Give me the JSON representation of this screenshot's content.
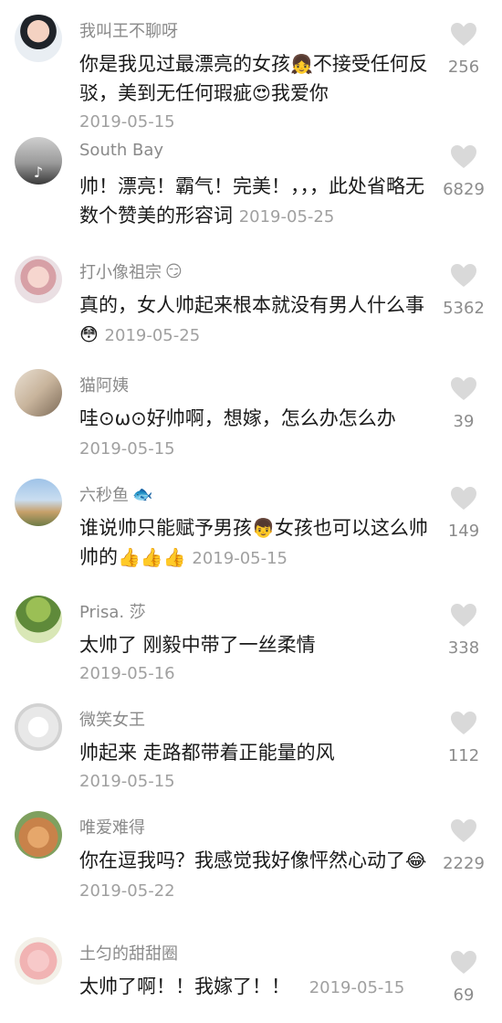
{
  "comments": [
    {
      "user": "我叫王不聊呀",
      "user_badge": "",
      "text": "你是我见过最漂亮的女孩👧不接受任何反驳，美到无任何瑕疵😍我爱你",
      "date": "2019-05-15",
      "likes": "256",
      "avatar_icon": "girl-portrait"
    },
    {
      "user": "South Bay",
      "user_badge": "",
      "text": "帅！漂亮！霸气！完美！，，，此处省略无数个赞美的形容词",
      "date": "2019-05-25",
      "likes": "6829",
      "avatar_icon": "tiktok-logo"
    },
    {
      "user": "打小像祖宗",
      "user_badge": "😏",
      "text": "真的，女人帅起来根本就没有男人什么事😳",
      "date": "2019-05-25",
      "likes": "5362",
      "avatar_icon": "girl-selfie"
    },
    {
      "user": "猫阿姨",
      "user_badge": "",
      "text": "哇⊙ω⊙好帅啊，想嫁，怎么办怎么办",
      "date": "2019-05-15",
      "likes": "39",
      "avatar_icon": "hand-photo"
    },
    {
      "user": "六秒鱼",
      "user_badge": "🐟",
      "text": "谁说帅只能赋予男孩👦女孩也可以这么帅帅的👍👍👍",
      "date": "2019-05-15",
      "likes": "149",
      "avatar_icon": "landscape-sky"
    },
    {
      "user": "Prisa. 莎",
      "user_badge": "",
      "text": "太帅了 刚毅中带了一丝柔情",
      "date": "2019-05-16",
      "likes": "338",
      "avatar_icon": "palm-tree"
    },
    {
      "user": "微笑女王",
      "user_badge": "",
      "text": "帅起来 走路都带着正能量的风",
      "date": "2019-05-15",
      "likes": "112",
      "avatar_icon": "sketch-drawing"
    },
    {
      "user": "唯爱难得",
      "user_badge": "",
      "text": "你在逗我吗？我感觉我好像怦然心动了😂",
      "date": "2019-05-22",
      "likes": "2229",
      "avatar_icon": "kitten"
    },
    {
      "user": "土匀的甜甜圈",
      "user_badge": "",
      "text": "太帅了啊！！我嫁了！！",
      "date": "2019-05-15",
      "likes": "69",
      "avatar_icon": "cartoon-pig"
    }
  ],
  "colors": {
    "username": "#8a8a8a",
    "body_text": "#1a1a1a",
    "date": "#a0a0a0",
    "heart": "#d9d9d9",
    "like_count": "#8c8c8c"
  }
}
